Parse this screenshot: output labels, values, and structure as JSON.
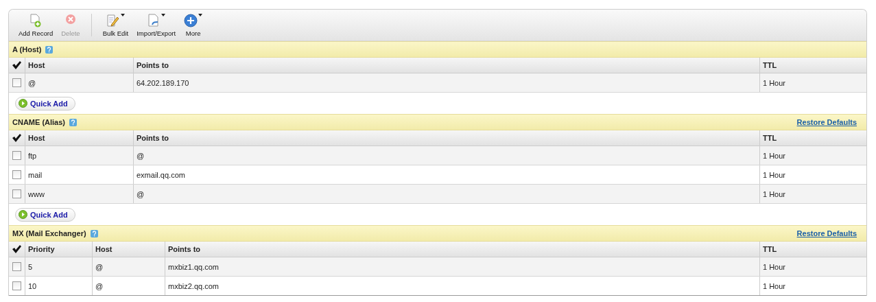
{
  "toolbar": [
    {
      "label": "Add Record",
      "disabled": false,
      "dropdown": false
    },
    {
      "label": "Delete",
      "disabled": true,
      "dropdown": false
    },
    {
      "label": "Bulk Edit",
      "disabled": false,
      "dropdown": true
    },
    {
      "label": "Import/Export",
      "disabled": false,
      "dropdown": true
    },
    {
      "label": "More",
      "disabled": false,
      "dropdown": true
    }
  ],
  "sections": [
    {
      "title": "A (Host)",
      "columns": [
        "Host",
        "Points to",
        "TTL"
      ],
      "rows": [
        {
          "checked": false,
          "cells": [
            "@",
            "64.202.189.170",
            "1 Hour"
          ]
        }
      ],
      "quick_add": "Quick Add"
    },
    {
      "title": "CNAME (Alias)",
      "restore": "Restore Defaults",
      "columns": [
        "Host",
        "Points to",
        "TTL"
      ],
      "rows": [
        {
          "checked": false,
          "cells": [
            "ftp",
            "@",
            "1 Hour"
          ]
        },
        {
          "checked": false,
          "cells": [
            "mail",
            "exmail.qq.com",
            "1 Hour"
          ]
        },
        {
          "checked": false,
          "cells": [
            "www",
            "@",
            "1 Hour"
          ]
        }
      ],
      "quick_add": "Quick Add"
    },
    {
      "title": "MX (Mail Exchanger)",
      "restore": "Restore Defaults",
      "columns": [
        "Priority",
        "Host",
        "Points to",
        "TTL"
      ],
      "rows": [
        {
          "checked": false,
          "cells": [
            "5",
            "@",
            "mxbiz1.qq.com",
            "1 Hour"
          ]
        },
        {
          "checked": false,
          "cells": [
            "10",
            "@",
            "mxbiz2.qq.com",
            "1 Hour"
          ]
        }
      ]
    }
  ]
}
